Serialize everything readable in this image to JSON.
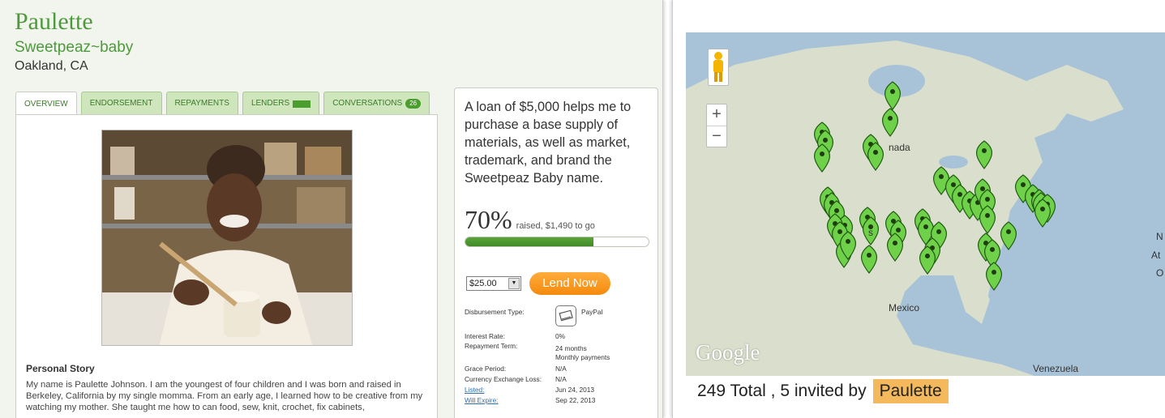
{
  "borrower": {
    "name": "Paulette",
    "business": "Sweetpeaz~baby",
    "location": "Oakland, CA"
  },
  "tabs": [
    {
      "label": "OVERVIEW",
      "active": true
    },
    {
      "label": "ENDORSEMENT"
    },
    {
      "label": "REPAYMENTS"
    },
    {
      "label": "LENDERS"
    },
    {
      "label": "CONVERSATIONS",
      "badge": "26"
    }
  ],
  "story": {
    "heading": "Personal Story",
    "text": "My name is Paulette Johnson. I am the youngest of four children and I was born and raised in Berkeley, California by my single momma. From an early age, I learned how to be creative from my watching my mother. She taught me how to can food, sew, knit, crochet, fix cabinets,"
  },
  "loan": {
    "use": "A loan of $5,000 helps me to purchase a base supply of materials, as well as market, trademark, and brand the Sweetpeaz Baby name.",
    "funded_pct_label": "70%",
    "funded_rest": "raised, $1,490 to go",
    "funded_fraction": 0.7,
    "amount": "$25.00",
    "lend_label": "Lend Now",
    "details": {
      "disbursement_label": "Disbursement Type:",
      "disbursement_value": "PayPal",
      "interest_label": "Interest Rate:",
      "interest_value": "0%",
      "term_label": "Repayment Term:",
      "term_value_1": "24 months",
      "term_value_2": "Monthly payments",
      "grace_label": "Grace Period:",
      "grace_value": "N/A",
      "fx_label": "Currency Exchange Loss:",
      "fx_value": "N/A",
      "listed_label": "Listed:",
      "listed_value": "Jun 24, 2013",
      "expire_label": "Will Expire:",
      "expire_value": "Sep 22, 2013"
    }
  },
  "map": {
    "labels": {
      "canada": "nada",
      "mexico": "Mexico",
      "venezuela": "Venezuela",
      "atlantic_1": "N",
      "atlantic_2": "At",
      "atlantic_3": "O",
      "s_label": "s"
    },
    "google": "Google",
    "zoom_in": "+",
    "zoom_out": "−",
    "summary_text": "249 Total , 5 invited by",
    "summary_name": "Paulette",
    "marker_color": "#6fd14a",
    "ocean_color": "#a8c3d8",
    "land_color": "#d9dfcc"
  }
}
